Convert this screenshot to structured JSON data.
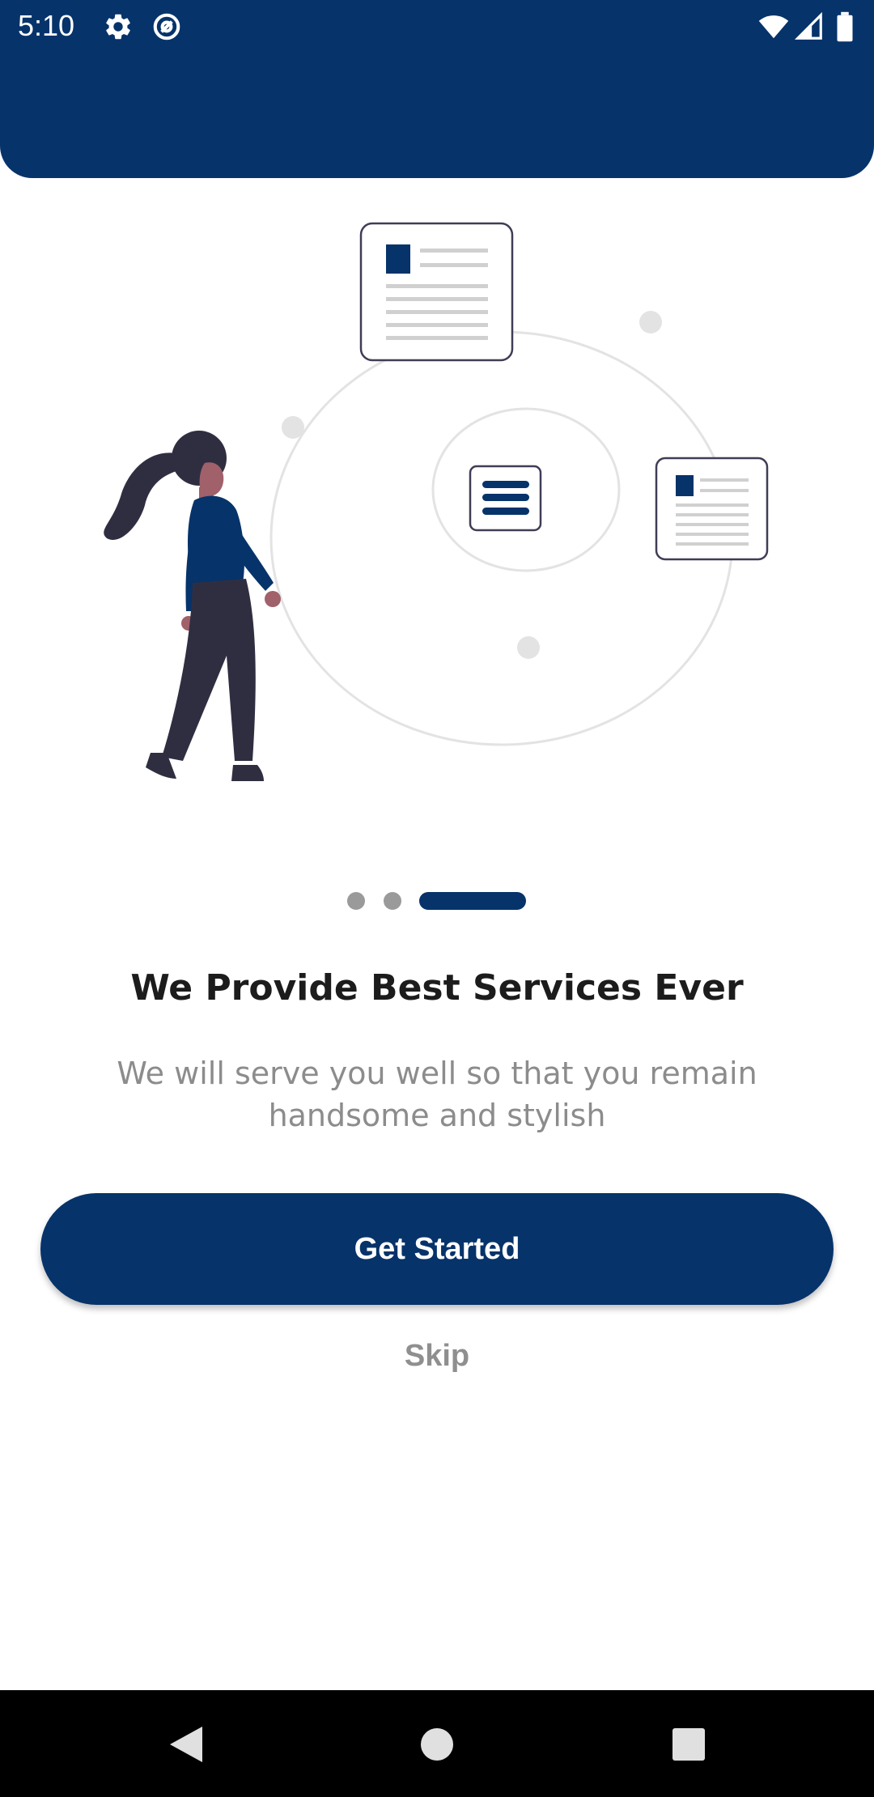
{
  "status_bar": {
    "time": "5:10",
    "left_icons": [
      "settings-gear-icon",
      "at-sign-icon"
    ],
    "right_icons": [
      "wifi-icon",
      "cell-signal-icon",
      "battery-icon"
    ]
  },
  "onboarding": {
    "page_count": 3,
    "active_page": 3,
    "title": "We Provide Best Services Ever",
    "subtitle": "We will serve you well so that you remain handsome and stylish",
    "primary_button_label": "Get Started",
    "skip_label": "Skip"
  },
  "nav_bar": {
    "buttons": [
      "back-triangle-icon",
      "home-circle-icon",
      "recents-square-icon"
    ]
  },
  "colors": {
    "brand_navy": "#06336a",
    "title_text": "#1c1c1c",
    "muted_text": "#8c8c8c",
    "inactive_dot": "#9a9a9a",
    "nav_background": "#000000"
  }
}
